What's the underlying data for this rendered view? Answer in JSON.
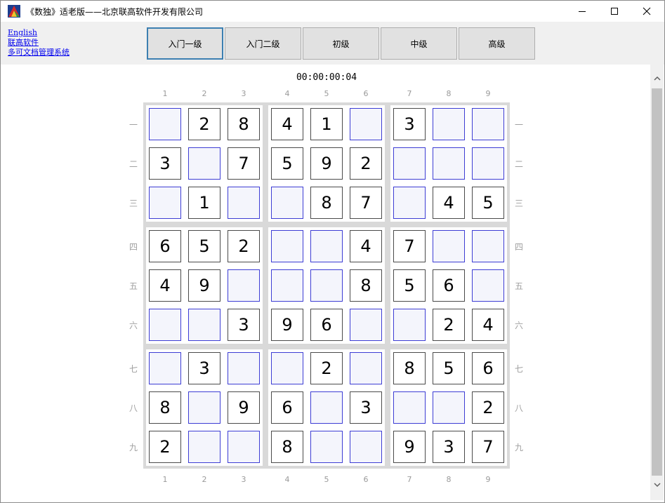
{
  "window": {
    "title": "《数独》适老版——北京联高软件开发有限公司",
    "controls": {
      "minimize": "minimize-icon",
      "maximize": "maximize-icon",
      "close": "close-icon"
    }
  },
  "links": [
    {
      "label": "English"
    },
    {
      "label": "联高软件"
    },
    {
      "label": "多可文档管理系统"
    }
  ],
  "levels": [
    {
      "label": "入门一级",
      "selected": true
    },
    {
      "label": "入门二级",
      "selected": false
    },
    {
      "label": "初级",
      "selected": false
    },
    {
      "label": "中级",
      "selected": false
    },
    {
      "label": "高级",
      "selected": false
    }
  ],
  "timer": "00:00:00:04",
  "column_labels": [
    "1",
    "2",
    "3",
    "4",
    "5",
    "6",
    "7",
    "8",
    "9"
  ],
  "row_labels": [
    "一",
    "二",
    "三",
    "四",
    "五",
    "六",
    "七",
    "八",
    "九"
  ],
  "grid": [
    [
      "",
      "2",
      "8",
      "4",
      "1",
      "",
      "3",
      "",
      ""
    ],
    [
      "3",
      "",
      "7",
      "5",
      "9",
      "2",
      "",
      "",
      ""
    ],
    [
      "",
      "1",
      "",
      "",
      "8",
      "7",
      "",
      "4",
      "5"
    ],
    [
      "6",
      "5",
      "2",
      "",
      "",
      "4",
      "7",
      "",
      ""
    ],
    [
      "4",
      "9",
      "",
      "",
      "",
      "8",
      "5",
      "6",
      ""
    ],
    [
      "",
      "",
      "3",
      "9",
      "6",
      "",
      "",
      "2",
      "4"
    ],
    [
      "",
      "3",
      "",
      "",
      "2",
      "",
      "8",
      "5",
      "6"
    ],
    [
      "8",
      "",
      "9",
      "6",
      "",
      "3",
      "",
      "",
      "2"
    ],
    [
      "2",
      "",
      "",
      "8",
      "",
      "",
      "9",
      "3",
      "7"
    ]
  ],
  "colors": {
    "empty_cell_border": "#3d3dd4",
    "empty_cell_fill": "#f4f5fc",
    "board_gap": "#d9d9d9",
    "active_tab_border": "#3c7fb1"
  }
}
